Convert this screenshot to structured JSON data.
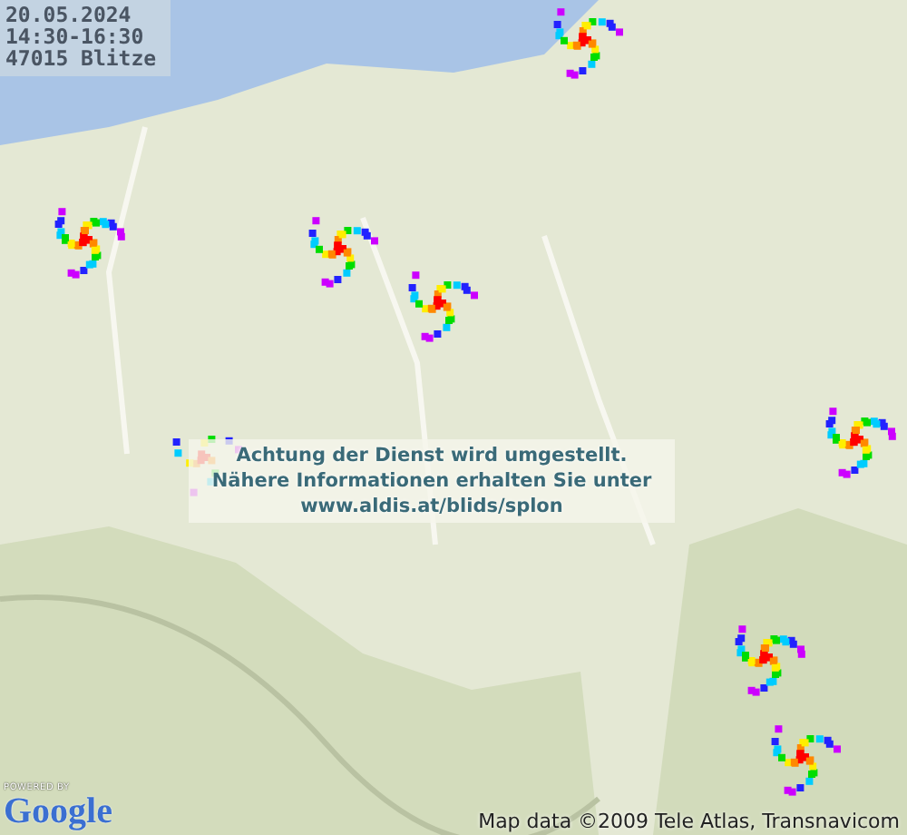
{
  "info_box": {
    "date": "20.05.2024",
    "time_range": "14:30-16:30",
    "count": "47015 Blitze"
  },
  "notice": {
    "lines": [
      "Achtung der Dienst wird umgestellt.",
      "Nähere Informationen erhalten Sie unter",
      "www.aldis.at/blids/splon"
    ]
  },
  "map": {
    "kind": "picture",
    "powered_by": "POWERED BY",
    "logo": "Google",
    "attribution": "Map data ©2009 Tele Atlas, Transnavicom"
  }
}
